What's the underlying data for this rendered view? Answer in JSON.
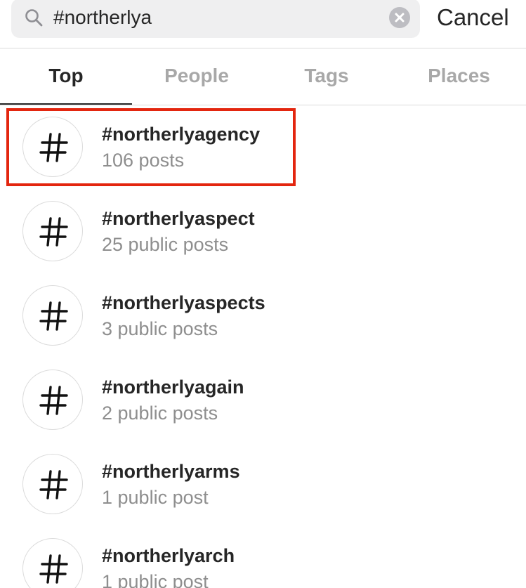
{
  "search": {
    "value": "#northerlya",
    "icon": "search-icon",
    "clear_icon": "clear-icon"
  },
  "header": {
    "cancel_label": "Cancel"
  },
  "tabs": [
    {
      "label": "Top",
      "active": true
    },
    {
      "label": "People",
      "active": false
    },
    {
      "label": "Tags",
      "active": false
    },
    {
      "label": "Places",
      "active": false
    }
  ],
  "results": [
    {
      "icon": "hashtag-icon",
      "name": "#northerlyagency",
      "count": "106 posts",
      "highlighted": true
    },
    {
      "icon": "hashtag-icon",
      "name": "#northerlyaspect",
      "count": "25 public posts",
      "highlighted": false
    },
    {
      "icon": "hashtag-icon",
      "name": "#northerlyaspects",
      "count": "3 public posts",
      "highlighted": false
    },
    {
      "icon": "hashtag-icon",
      "name": "#northerlyagain",
      "count": "2 public posts",
      "highlighted": false
    },
    {
      "icon": "hashtag-icon",
      "name": "#northerlyarms",
      "count": "1 public post",
      "highlighted": false
    },
    {
      "icon": "hashtag-icon",
      "name": "#northerlyarch",
      "count": "1 public post",
      "highlighted": false
    }
  ],
  "colors": {
    "highlight": "#e3260f",
    "primary_text": "#262626",
    "secondary_text": "#8e8e8e",
    "inactive_tab": "#a8a8a8",
    "search_background": "#efeff0"
  }
}
